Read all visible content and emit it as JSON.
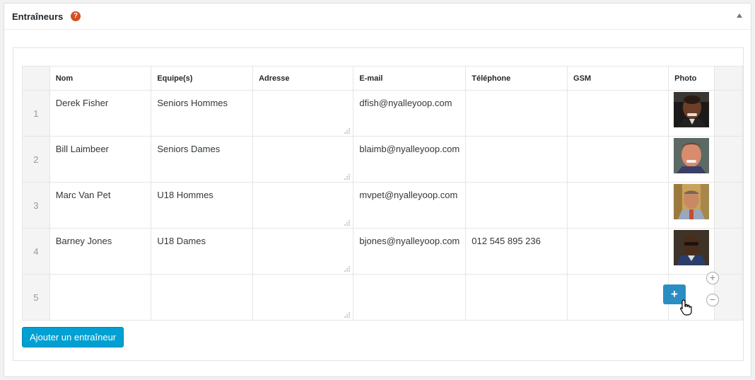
{
  "panel": {
    "title": "Entraîneurs",
    "help_icon": "?"
  },
  "table": {
    "columns": [
      "Nom",
      "Equipe(s)",
      "Adresse",
      "E-mail",
      "Téléphone",
      "GSM",
      "Photo"
    ],
    "rows": [
      {
        "num": "1",
        "nom": "Derek Fisher",
        "equipe": "Seniors Hommes",
        "adresse": "",
        "email": "dfish@nyalleyoop.com",
        "telephone": "",
        "gsm": "",
        "photo": "avatar-derek"
      },
      {
        "num": "2",
        "nom": "Bill Laimbeer",
        "equipe": "Seniors Dames",
        "adresse": "",
        "email": "blaimb@nyalleyoop.com",
        "telephone": "",
        "gsm": "",
        "photo": "avatar-bill"
      },
      {
        "num": "3",
        "nom": "Marc Van Pet",
        "equipe": "U18 Hommes",
        "adresse": "",
        "email": "mvpet@nyalleyoop.com",
        "telephone": "",
        "gsm": "",
        "photo": "avatar-marc"
      },
      {
        "num": "4",
        "nom": "Barney Jones",
        "equipe": "U18 Dames",
        "adresse": "",
        "email": "bjones@nyalleyoop.com",
        "telephone": "012 545 895 236",
        "gsm": "",
        "photo": "avatar-barney"
      },
      {
        "num": "5",
        "nom": "",
        "equipe": "",
        "adresse": "",
        "email": "",
        "telephone": "",
        "gsm": "",
        "photo": ""
      }
    ]
  },
  "controls": {
    "add_row": "+",
    "remove_row": "−",
    "add_photo": "+",
    "add_coach_label": "Ajouter un entraîneur"
  },
  "icons": [
    "help-icon",
    "collapse-arrow-icon",
    "plus-icon",
    "minus-icon",
    "pointer-cursor-icon",
    "resize-handle-icon"
  ],
  "colors": {
    "primary": "#00a0d2",
    "add_photo": "#2a8ec2",
    "help": "#d54e21"
  }
}
